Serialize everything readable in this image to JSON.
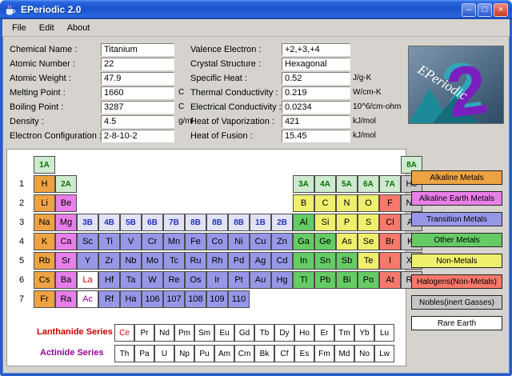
{
  "window": {
    "title": "EPeriodic 2.0",
    "controls": {
      "minimize": "–",
      "maximize": "□",
      "close": "×"
    }
  },
  "menu": [
    "File",
    "Edit",
    "About"
  ],
  "logo": {
    "brand": "EPeriodic",
    "numeral": "2"
  },
  "form": {
    "left": [
      {
        "label": "Chemical Name :",
        "value": "Titanium",
        "unit": ""
      },
      {
        "label": "Atomic Number :",
        "value": "22",
        "unit": ""
      },
      {
        "label": "Atomic Weight :",
        "value": "47.9",
        "unit": ""
      },
      {
        "label": "Melting Point :",
        "value": "1660",
        "unit": "C"
      },
      {
        "label": "Boiling Point :",
        "value": "3287",
        "unit": "C"
      },
      {
        "label": "Density :",
        "value": "4.5",
        "unit": "g/ml"
      },
      {
        "label": "Electron Configuration :",
        "value": "2-8-10-2",
        "unit": ""
      }
    ],
    "right": [
      {
        "label": "Valence Electron :",
        "value": "+2,+3,+4",
        "unit": ""
      },
      {
        "label": "Crystal Structure :",
        "value": "Hexagonal",
        "unit": ""
      },
      {
        "label": "Specific Heat :",
        "value": "0.52",
        "unit": "J/g-K"
      },
      {
        "label": "Thermal Conductivity :",
        "value": "0.219",
        "unit": "W/cm-K"
      },
      {
        "label": "Electrical Conductivity :",
        "value": "0.0234",
        "unit": "10^6/cm-ohm"
      },
      {
        "label": "Heat of Vaporization :",
        "value": "421",
        "unit": "kJ/mol"
      },
      {
        "label": "Heat of Fusion :",
        "value": "15.45",
        "unit": "kJ/mol"
      }
    ]
  },
  "colors": {
    "category": {
      "alk": "#EDA343",
      "ae": "#E87FE8",
      "tm": "#9797E8",
      "om": "#65CB65",
      "nm": "#EFEF6E",
      "hal": "#F7796B",
      "nob": "#C6C6C6",
      "re": "#FFFFFF",
      "la": "#FFFFFF",
      "ac": "#FFFFFF",
      "lblA": "#CFEACF",
      "lblB": "#E2E2F5"
    },
    "series_label_lanthanide": "#CC0000",
    "series_label_actinide": "#990099"
  },
  "table": {
    "lanthanide_label": "Lanthanide Series",
    "actinide_label": "Actinide Series",
    "rows": [
      {
        "period": "",
        "cells": [
          [
            "1A",
            1,
            "lblA"
          ],
          [
            "8A",
            18,
            "lblA"
          ]
        ]
      },
      {
        "period": "1",
        "cells": [
          [
            "H",
            1,
            "alk"
          ],
          [
            "2A",
            2,
            "lblA"
          ],
          [
            "3A",
            13,
            "lblA"
          ],
          [
            "4A",
            14,
            "lblA"
          ],
          [
            "5A",
            15,
            "lblA"
          ],
          [
            "6A",
            16,
            "lblA"
          ],
          [
            "7A",
            17,
            "lblA"
          ],
          [
            "He",
            18,
            "nob"
          ]
        ]
      },
      {
        "period": "2",
        "cells": [
          [
            "Li",
            1,
            "alk"
          ],
          [
            "Be",
            2,
            "ae"
          ],
          [
            "B",
            13,
            "nm"
          ],
          [
            "C",
            14,
            "nm"
          ],
          [
            "N",
            15,
            "nm"
          ],
          [
            "O",
            16,
            "nm"
          ],
          [
            "F",
            17,
            "hal"
          ],
          [
            "Ne",
            18,
            "nob"
          ]
        ]
      },
      {
        "period": "3",
        "cells": [
          [
            "Na",
            1,
            "alk"
          ],
          [
            "Mg",
            2,
            "ae"
          ],
          [
            "3B",
            3,
            "lblB"
          ],
          [
            "4B",
            4,
            "lblB"
          ],
          [
            "5B",
            5,
            "lblB"
          ],
          [
            "6B",
            6,
            "lblB"
          ],
          [
            "7B",
            7,
            "lblB"
          ],
          [
            "8B",
            8,
            "lblB"
          ],
          [
            "8B",
            9,
            "lblB"
          ],
          [
            "8B",
            10,
            "lblB"
          ],
          [
            "1B",
            11,
            "lblB"
          ],
          [
            "2B",
            12,
            "lblB"
          ],
          [
            "Al",
            13,
            "om"
          ],
          [
            "Si",
            14,
            "nm"
          ],
          [
            "P",
            15,
            "nm"
          ],
          [
            "S",
            16,
            "nm"
          ],
          [
            "Cl",
            17,
            "hal"
          ],
          [
            "Ar",
            18,
            "nob"
          ]
        ]
      },
      {
        "period": "4",
        "cells": [
          [
            "K",
            1,
            "alk"
          ],
          [
            "Ca",
            2,
            "ae"
          ],
          [
            "Sc",
            3,
            "tm"
          ],
          [
            "Ti",
            4,
            "tm"
          ],
          [
            "V",
            5,
            "tm"
          ],
          [
            "Cr",
            6,
            "tm"
          ],
          [
            "Mn",
            7,
            "tm"
          ],
          [
            "Fe",
            8,
            "tm"
          ],
          [
            "Co",
            9,
            "tm"
          ],
          [
            "Ni",
            10,
            "tm"
          ],
          [
            "Cu",
            11,
            "tm"
          ],
          [
            "Zn",
            12,
            "tm"
          ],
          [
            "Ga",
            13,
            "om"
          ],
          [
            "Ge",
            14,
            "om"
          ],
          [
            "As",
            15,
            "nm"
          ],
          [
            "Se",
            16,
            "nm"
          ],
          [
            "Br",
            17,
            "hal"
          ],
          [
            "Kr",
            18,
            "nob"
          ]
        ]
      },
      {
        "period": "5",
        "cells": [
          [
            "Rb",
            1,
            "alk"
          ],
          [
            "Sr",
            2,
            "ae"
          ],
          [
            "Y",
            3,
            "tm"
          ],
          [
            "Zr",
            4,
            "tm"
          ],
          [
            "Nb",
            5,
            "tm"
          ],
          [
            "Mo",
            6,
            "tm"
          ],
          [
            "Tc",
            7,
            "tm"
          ],
          [
            "Ru",
            8,
            "tm"
          ],
          [
            "Rh",
            9,
            "tm"
          ],
          [
            "Pd",
            10,
            "tm"
          ],
          [
            "Ag",
            11,
            "tm"
          ],
          [
            "Cd",
            12,
            "tm"
          ],
          [
            "In",
            13,
            "om"
          ],
          [
            "Sn",
            14,
            "om"
          ],
          [
            "Sb",
            15,
            "om"
          ],
          [
            "Te",
            16,
            "nm"
          ],
          [
            "I",
            17,
            "hal"
          ],
          [
            "Xe",
            18,
            "nob"
          ]
        ]
      },
      {
        "period": "6",
        "cells": [
          [
            "Cs",
            1,
            "alk"
          ],
          [
            "Ba",
            2,
            "ae"
          ],
          [
            "La",
            3,
            "la"
          ],
          [
            "Hf",
            4,
            "tm"
          ],
          [
            "Ta",
            5,
            "tm"
          ],
          [
            "W",
            6,
            "tm"
          ],
          [
            "Re",
            7,
            "tm"
          ],
          [
            "Os",
            8,
            "tm"
          ],
          [
            "Ir",
            9,
            "tm"
          ],
          [
            "Pt",
            10,
            "tm"
          ],
          [
            "Au",
            11,
            "tm"
          ],
          [
            "Hg",
            12,
            "tm"
          ],
          [
            "Tl",
            13,
            "om"
          ],
          [
            "Pb",
            14,
            "om"
          ],
          [
            "Bi",
            15,
            "om"
          ],
          [
            "Po",
            16,
            "om"
          ],
          [
            "At",
            17,
            "hal"
          ],
          [
            "Rn",
            18,
            "nob"
          ]
        ]
      },
      {
        "period": "7",
        "cells": [
          [
            "Fr",
            1,
            "alk"
          ],
          [
            "Ra",
            2,
            "ae"
          ],
          [
            "Ac",
            3,
            "ac"
          ],
          [
            "Rf",
            4,
            "tm"
          ],
          [
            "Ha",
            5,
            "tm"
          ],
          [
            "106",
            6,
            "tm"
          ],
          [
            "107",
            7,
            "tm"
          ],
          [
            "108",
            8,
            "tm"
          ],
          [
            "109",
            9,
            "tm"
          ],
          [
            "110",
            10,
            "tm"
          ]
        ]
      }
    ],
    "lanthanides": [
      [
        "Ce",
        "la"
      ],
      [
        "Pr",
        "re"
      ],
      [
        "Nd",
        "re"
      ],
      [
        "Pm",
        "re"
      ],
      [
        "Sm",
        "re"
      ],
      [
        "Eu",
        "re"
      ],
      [
        "Gd",
        "re"
      ],
      [
        "Tb",
        "re"
      ],
      [
        "Dy",
        "re"
      ],
      [
        "Ho",
        "re"
      ],
      [
        "Er",
        "re"
      ],
      [
        "Tm",
        "re"
      ],
      [
        "Yb",
        "re"
      ],
      [
        "Lu",
        "re"
      ]
    ],
    "actinides": [
      [
        "Th",
        "re"
      ],
      [
        "Pa",
        "re"
      ],
      [
        "U",
        "re"
      ],
      [
        "Np",
        "re"
      ],
      [
        "Pu",
        "re"
      ],
      [
        "Am",
        "re"
      ],
      [
        "Cm",
        "re"
      ],
      [
        "Bk",
        "re"
      ],
      [
        "Cf",
        "re"
      ],
      [
        "Es",
        "re"
      ],
      [
        "Fm",
        "re"
      ],
      [
        "Md",
        "re"
      ],
      [
        "No",
        "re"
      ],
      [
        "Lw",
        "re"
      ]
    ]
  },
  "legend": [
    {
      "label": "Alkaline Metals",
      "color": "#EDA343"
    },
    {
      "label": "Alkaline Earth Metals",
      "color": "#E87FE8"
    },
    {
      "label": "Transition Metals",
      "color": "#9797E8"
    },
    {
      "label": "Other Metals",
      "color": "#65CB65"
    },
    {
      "label": "Non-Metals",
      "color": "#EFEF6E"
    },
    {
      "label": "Halogens(Non-Metals)",
      "color": "#F7796B"
    },
    {
      "label": "Nobles(inert Gasses)",
      "color": "#C6C6C6"
    },
    {
      "label": "Rare Earth",
      "color": "#FFFFFF"
    }
  ]
}
